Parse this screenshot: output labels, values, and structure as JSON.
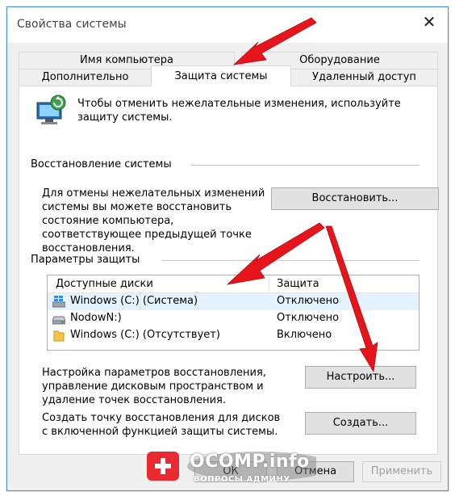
{
  "window": {
    "title": "Свойства системы",
    "close_glyph": "✕"
  },
  "tabs": {
    "row1": [
      "Имя компьютера",
      "Оборудование"
    ],
    "row2": [
      "Дополнительно",
      "Защита системы",
      "Удаленный доступ"
    ],
    "active": "Защита системы"
  },
  "info": {
    "text": "Чтобы отменить нежелательные изменения, используйте защиту системы."
  },
  "restore": {
    "section_label": "Восстановление системы",
    "description": "Для отмены нежелательных изменений системы вы можете восстановить состояние компьютера, соответствующее предыдущей точке восстановления.",
    "button_label": "Восстановить..."
  },
  "protection": {
    "section_label": "Параметры защиты",
    "columns": [
      "Доступные диски",
      "Защита"
    ],
    "drives": [
      {
        "name": "Windows (C:) (Система)",
        "status": "Отключено",
        "icon": "windows-drive-icon",
        "selected": true
      },
      {
        "name": "NodowN:)",
        "status": "Отключено",
        "icon": "drive-icon",
        "selected": false
      },
      {
        "name": "Windows (C:) (Отсутствует)",
        "status": "Включено",
        "icon": "folder-icon",
        "selected": false
      }
    ],
    "configure_description": "Настройка параметров восстановления, управление дисковым пространством и удаление точек восстановления.",
    "configure_label": "Настроить...",
    "create_description": "Создать точку восстановления для дисков с включенной функцией защиты системы.",
    "create_label": "Создать..."
  },
  "footer": {
    "ok_label": "ОК",
    "cancel_label": "Отмена",
    "apply_label": "Применить"
  },
  "watermark": {
    "title": "OCOMP.info",
    "subtitle": "ВОПРОСЫ АДМИНУ"
  },
  "colors": {
    "annotation_arrow": "#e8141c",
    "selection": "#e5f3ff",
    "window_border": "#4a90d9"
  }
}
